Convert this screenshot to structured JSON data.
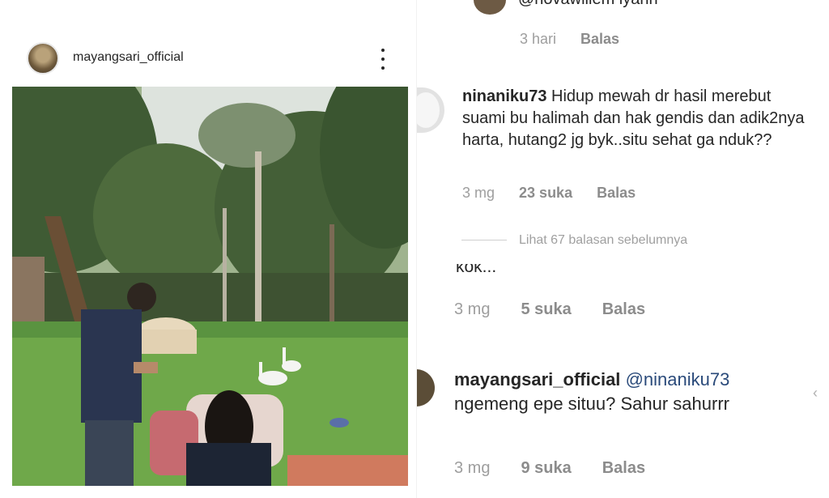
{
  "left_post": {
    "username": "mayangsari_official",
    "more_icon": "more-vertical-icon"
  },
  "comments": {
    "top": {
      "text": "@novawillem iyahh",
      "time": "3 hari",
      "reply": "Balas"
    },
    "ninaniku": {
      "username": "ninaniku73",
      "text": "Hidup mewah dr hasil merebut suami bu halimah dan hak gendis dan adik2nya harta,  hutang2 jg byk..situ sehat ga nduk??",
      "time": "3 mg",
      "likes": "23 suka",
      "reply": "Balas"
    },
    "view_replies": "Lihat 67 balasan sebelumnya",
    "truncated_text": "kok...",
    "truncated_meta": {
      "time": "3 mg",
      "likes": "5 suka",
      "reply": "Balas"
    },
    "mayangsari": {
      "username": "mayangsari_official",
      "mention": "@ninaniku73",
      "text": "ngemeng epe situu? Sahur sahurrr",
      "time": "3 mg",
      "likes": "9 suka",
      "reply": "Balas"
    }
  },
  "colors": {
    "text": "#262626",
    "meta": "#9e9e9e",
    "mention": "#2a4a7a"
  }
}
